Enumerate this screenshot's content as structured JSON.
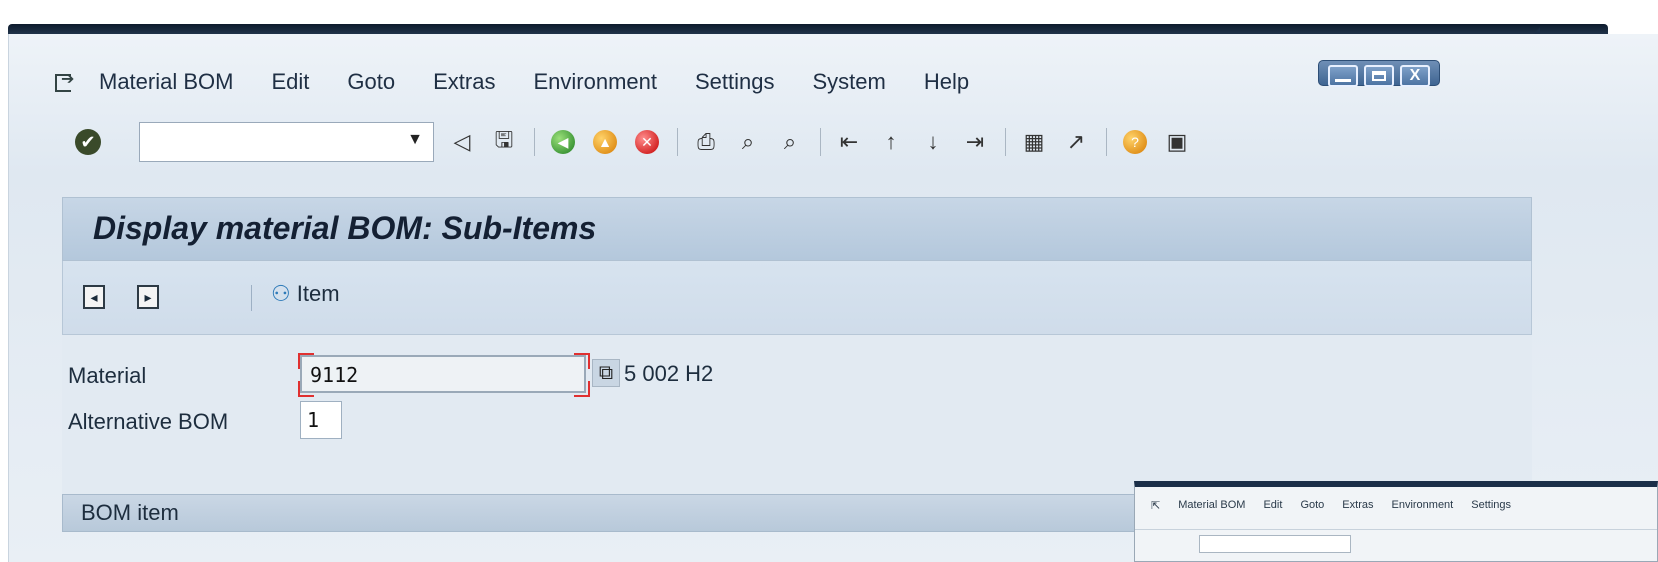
{
  "menubar": {
    "items": [
      {
        "label": "Material BOM"
      },
      {
        "label": "Edit"
      },
      {
        "label": "Goto"
      },
      {
        "label": "Extras"
      },
      {
        "label": "Environment"
      },
      {
        "label": "Settings"
      },
      {
        "label": "System"
      },
      {
        "label": "Help"
      }
    ]
  },
  "toolbar": {
    "command_value": ""
  },
  "window_controls": {
    "close_label": "X"
  },
  "page": {
    "title": "Display material BOM: Sub-Items"
  },
  "app_toolbar": {
    "item_label": "Item"
  },
  "form": {
    "material_label": "Material",
    "material_value": "9112",
    "material_description": "5 002 H2",
    "alt_bom_label": "Alternative BOM",
    "alt_bom_value": "1"
  },
  "section": {
    "bom_item_label": "BOM item"
  },
  "thumbnail": {
    "menu": [
      "Material BOM",
      "Edit",
      "Goto",
      "Extras",
      "Environment",
      "Settings"
    ]
  },
  "colors": {
    "title_bar": "#1b2f49",
    "panel": "#c7d6e6",
    "focus_bracket": "#e03030"
  }
}
